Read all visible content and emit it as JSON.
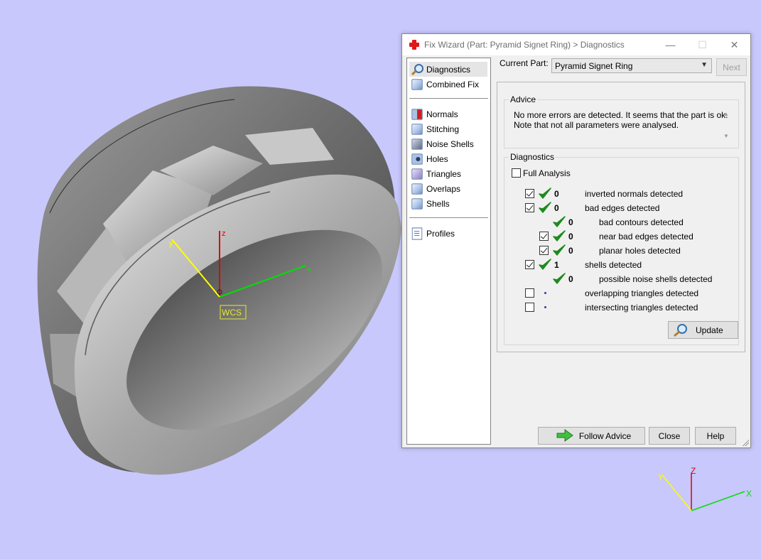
{
  "viewport": {
    "wcs_label": "WCS",
    "axis_labels": {
      "x": "x",
      "y": "y",
      "z": "z"
    },
    "mini_axis_labels": {
      "x": "X",
      "y": "Y",
      "z": "Z"
    },
    "background_color": "#c8c8fc"
  },
  "dialog": {
    "title": "Fix Wizard (Part: Pyramid Signet Ring) > Diagnostics",
    "window_buttons": {
      "minimize": "—",
      "maximize": "☐",
      "close": "✕"
    },
    "nav": {
      "top_items": [
        {
          "label": "Diagnostics",
          "icon": "magnifier-icon",
          "selected": true
        },
        {
          "label": "Combined Fix",
          "icon": "cube-icon",
          "selected": false
        }
      ],
      "fix_items": [
        {
          "label": "Normals",
          "icon": "normals-icon"
        },
        {
          "label": "Stitching",
          "icon": "stitching-icon"
        },
        {
          "label": "Noise Shells",
          "icon": "noise-shells-icon"
        },
        {
          "label": "Holes",
          "icon": "holes-icon"
        },
        {
          "label": "Triangles",
          "icon": "triangles-icon"
        },
        {
          "label": "Overlaps",
          "icon": "overlaps-icon"
        },
        {
          "label": "Shells",
          "icon": "shells-icon"
        }
      ],
      "bottom_items": [
        {
          "label": "Profiles",
          "icon": "profiles-icon"
        }
      ]
    },
    "current_part": {
      "label": "Current Part:",
      "value": "Pyramid Signet Ring"
    },
    "next_label": "Next",
    "advice": {
      "title": "Advice",
      "text": "No more errors are detected. It seems that the part is ok.\nNote that not all parameters were analysed."
    },
    "diagnostics": {
      "title": "Diagnostics",
      "full_analysis_label": "Full Analysis",
      "full_analysis_checked": false,
      "rows": [
        {
          "checkbox": true,
          "checked": true,
          "status": "ok",
          "count": "0",
          "label": "inverted normals detected",
          "indent": 0
        },
        {
          "checkbox": true,
          "checked": true,
          "status": "ok",
          "count": "0",
          "label": "bad edges detected",
          "indent": 0
        },
        {
          "checkbox": false,
          "checked": false,
          "status": "ok",
          "count": "0",
          "label": "bad contours detected",
          "indent": 1
        },
        {
          "checkbox": true,
          "checked": true,
          "status": "ok",
          "count": "0",
          "label": "near bad edges detected",
          "indent": 1
        },
        {
          "checkbox": true,
          "checked": true,
          "status": "ok",
          "count": "0",
          "label": "planar holes detected",
          "indent": 1
        },
        {
          "checkbox": true,
          "checked": true,
          "status": "ok",
          "count": "1",
          "label": "shells detected",
          "indent": 0
        },
        {
          "checkbox": false,
          "checked": false,
          "status": "ok",
          "count": "0",
          "label": "possible noise shells detected",
          "indent": 1
        },
        {
          "checkbox": true,
          "checked": false,
          "status": "pending",
          "count": "",
          "label": "overlapping triangles detected",
          "indent": 0
        },
        {
          "checkbox": true,
          "checked": false,
          "status": "pending",
          "count": "",
          "label": "intersecting triangles detected",
          "indent": 0
        }
      ],
      "update_label": "Update"
    },
    "buttons": {
      "follow_advice": "Follow Advice",
      "close": "Close",
      "help": "Help"
    }
  }
}
